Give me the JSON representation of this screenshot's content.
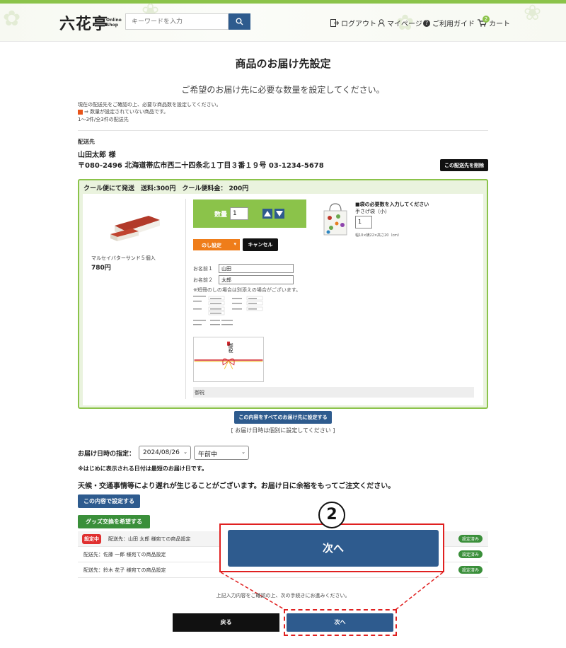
{
  "header": {
    "logo_text": "六花亭",
    "logo_sub_line1": "Online",
    "logo_sub_line2": "Shop",
    "search_placeholder": "キーワードを入力",
    "nav": {
      "logout": "ログアウト",
      "mypage": "マイページ",
      "guide": "ご利用ガイド",
      "cart": "カート",
      "cart_count": "2"
    }
  },
  "page": {
    "title": "商品のお届け先設定",
    "subtitle": "ご希望のお届け先に必要な数量を設定してください。",
    "notes": [
      "現在の配送先をご確認の上、必要な商品数を設定してください。",
      "⇒ 数量が設定されていない商品です。",
      "1〜3件/全3件の配送先"
    ]
  },
  "address": {
    "label": "配送先",
    "name": "山田太郎 様",
    "line": "〒080-2496 北海道帯広市西二十四条北１丁目３番１９号 03-1234-5678",
    "delete_button": "この配送先を削除"
  },
  "shipment": {
    "header": "クール便にて発送　送料:300円　クール便料金： 200円",
    "product_name": "マルセイバターサンド５個入",
    "product_price": "780円",
    "qty_label": "数量",
    "qty_value": "1",
    "bag_title": "■袋の必要数を入力してください",
    "bag_name": "手さげ袋（小）",
    "bag_qty": "1",
    "bag_size": "幅10×横22×高さ20（cm）",
    "noshi_button": "のし設定",
    "cancel_button": "キャンセル",
    "name1_label": "お名前１",
    "name1_value": "山田",
    "name2_label": "お名前２",
    "name2_value": "太郎",
    "hint": "※短冊のしの場合は別添えの場合がございます。",
    "noshi_caption": "御祝",
    "noshi_preview_text": "御祝"
  },
  "apply_all": {
    "button": "この内容をすべてのお届け先に設定する",
    "note": "[ お届け日時は個別に設定してください ]"
  },
  "delivery": {
    "label": "お届け日時の指定：",
    "date": "2024/08/26",
    "time": "午前中",
    "note": "※はじめに表示される日付は最短のお届け日です。",
    "warning": "天候・交通事情等により遅れが生じることがございます。お届け日に余裕をもってご注文ください。"
  },
  "actions": {
    "set_button": "この内容で設定する",
    "goods_button": "グッズ交換を希望する"
  },
  "destinations": [
    {
      "badge": "設定中",
      "text": "配送先：山田 太郎 様宛ての商品設定",
      "status": "設定済み"
    },
    {
      "badge": "",
      "text": "配送先：佐藤 一郎 様宛ての商品設定",
      "status": "設定済み"
    },
    {
      "badge": "",
      "text": "配送先：鈴木 花子 様宛ての商品設定",
      "status": "設定済み"
    }
  ],
  "overlay": {
    "step_number": "2",
    "next_big": "次へ"
  },
  "footer": {
    "note": "上記入力内容をご確認の上、次の手続きにお進みください。",
    "back_button": "戻る",
    "next_button": "次へ"
  },
  "colors": {
    "brand_green": "#8bc34a",
    "brand_blue": "#2e5b8e",
    "highlight_red": "#e02020"
  }
}
